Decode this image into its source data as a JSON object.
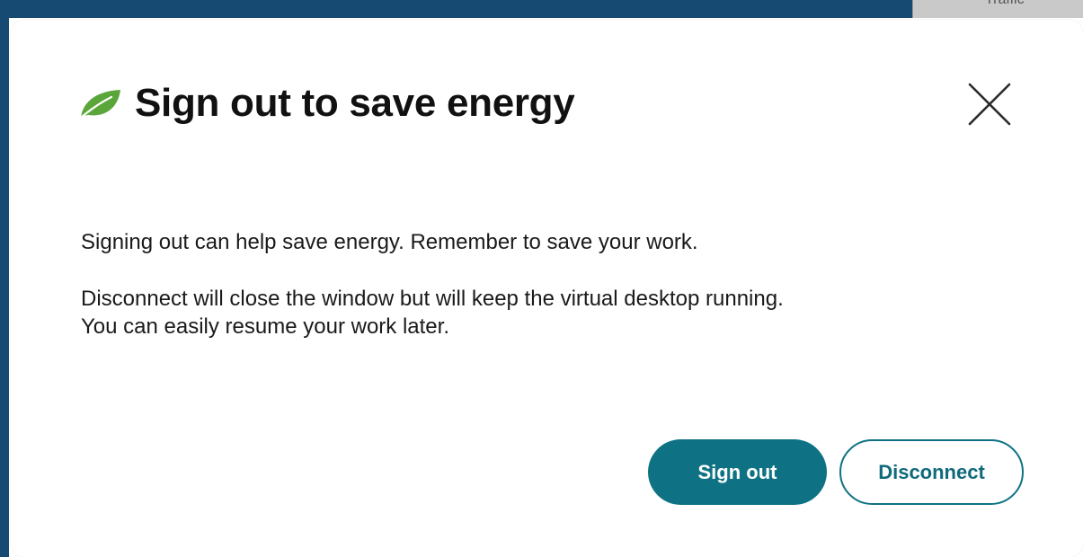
{
  "backdrop": {
    "window_label": "Traffic"
  },
  "dialog": {
    "title": "Sign out to save energy",
    "title_icon": "leaf-icon",
    "close_icon": "close-icon",
    "message_1": "Signing out can help save energy. Remember to save your work.",
    "message_2_line_1": "Disconnect will close the window but will keep the virtual desktop running.",
    "message_2_line_2": "You can easily resume your work later.",
    "buttons": {
      "sign_out": "Sign out",
      "disconnect": "Disconnect"
    }
  },
  "colors": {
    "accent": "#0f7284",
    "leaf": "#5aa63a",
    "backdrop": "#174a72"
  }
}
